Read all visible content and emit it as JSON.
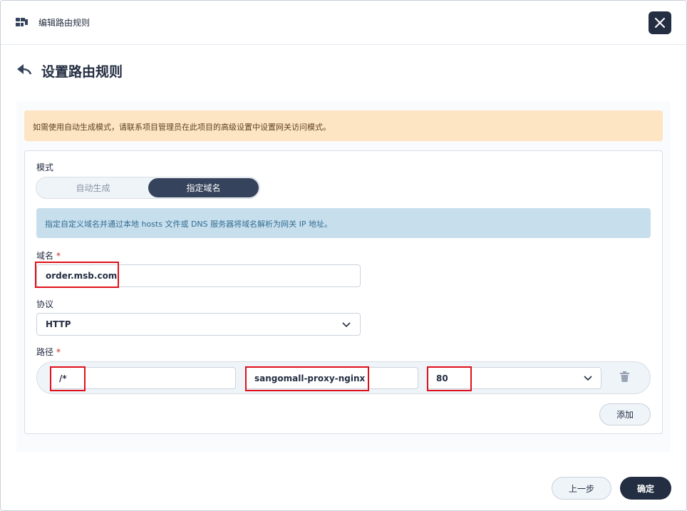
{
  "window": {
    "title": "编辑路由规则",
    "icon": "app-grid-icon",
    "close_icon": "close-icon"
  },
  "page": {
    "title": "设置路由规则",
    "back_icon": "back-arrow-icon"
  },
  "warning": {
    "text": "如需使用自动生成模式，请联系项目管理员在此项目的高级设置中设置网关访问模式。"
  },
  "mode": {
    "label": "模式",
    "options": [
      "自动生成",
      "指定域名"
    ],
    "selected": "指定域名"
  },
  "info": {
    "text": "指定自定义域名并通过本地 hosts 文件或 DNS 服务器将域名解析为网关 IP 地址。"
  },
  "domain": {
    "label": "域名",
    "required_mark": "*",
    "value": "order.msb.com"
  },
  "protocol": {
    "label": "协议",
    "value": "HTTP"
  },
  "path": {
    "label": "路径",
    "required_mark": "*",
    "path_value": "/*",
    "service_value": "sangomall-proxy-nginx",
    "port_value": "80"
  },
  "buttons": {
    "add": "添加",
    "prev": "上一步",
    "ok": "确定"
  },
  "colors": {
    "accent": "#242e42",
    "warning_bg": "#fde4c2",
    "info_bg": "#c7deec",
    "highlight": "#e0101a"
  }
}
